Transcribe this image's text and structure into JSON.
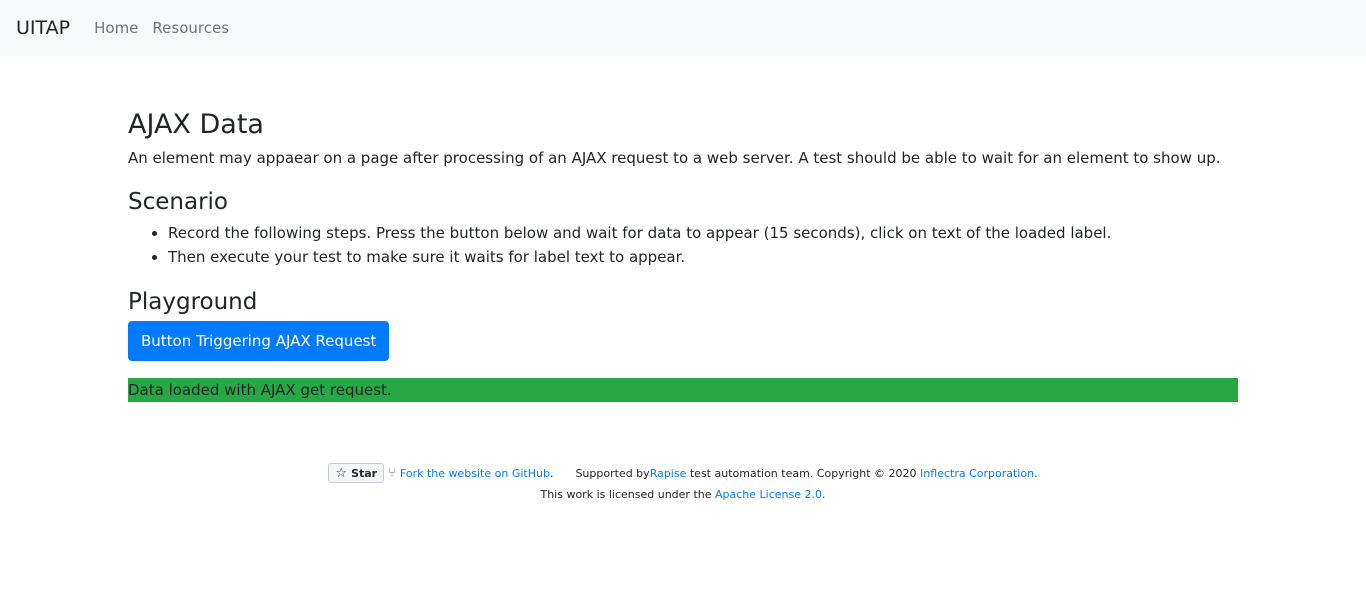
{
  "navbar": {
    "brand": "UITAP",
    "links": [
      "Home",
      "Resources"
    ]
  },
  "main": {
    "title": "AJAX Data",
    "description": "An element may appaear on a page after processing of an AJAX request to a web server. A test should be able to wait for an element to show up.",
    "scenario_heading": "Scenario",
    "steps": [
      "Record the following steps. Press the button below and wait for data to appear (15 seconds), click on text of the loaded label.",
      "Then execute your test to make sure it waits for label text to appear."
    ],
    "playground_heading": "Playground",
    "button_label": "Button Triggering AJAX Request",
    "loaded_label": "Data loaded with AJAX get request."
  },
  "footer": {
    "star_label": "Star",
    "fork_link": "Fork the website on GitHub",
    "fork_suffix": ".",
    "supported_prefix": "Supported by ",
    "rapise_link": "Rapise",
    "supported_middle": " test automation team. Copyright © 2020 ",
    "inflectra_link": "Inflectra Corporation",
    "supported_suffix": ".",
    "license_prefix": "This work is licensed under the ",
    "license_link": "Apache License 2.0",
    "license_suffix": "."
  },
  "colors": {
    "primary": "#007bff",
    "success": "#28a745",
    "navbar_bg": "#f8f9fa"
  },
  "icons": [
    "star-icon",
    "fork-icon"
  ]
}
